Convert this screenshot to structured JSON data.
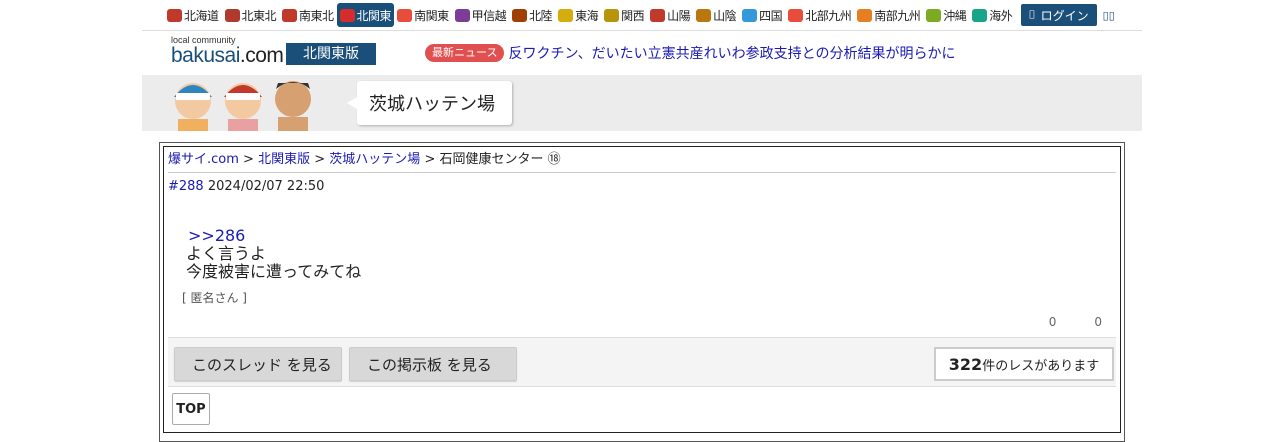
{
  "regions": [
    {
      "label": "北海道",
      "icon": "crab-icon",
      "color": "#c0392b"
    },
    {
      "label": "北東北",
      "icon": "namahage-icon",
      "color": "#b03a2e"
    },
    {
      "label": "南東北",
      "icon": "ship-icon",
      "color": "#c0392b"
    },
    {
      "label": "北関東",
      "icon": "daruma-icon",
      "color": "#d62c2c",
      "active": true
    },
    {
      "label": "南関東",
      "icon": "tower-icon",
      "color": "#e74c3c"
    },
    {
      "label": "甲信越",
      "icon": "grape-icon",
      "color": "#7d3c98"
    },
    {
      "label": "北陸",
      "icon": "shrine-icon",
      "color": "#a04000"
    },
    {
      "label": "東海",
      "icon": "shachihoko-icon",
      "color": "#d4ac0d"
    },
    {
      "label": "関西",
      "icon": "takoyaki-icon",
      "color": "#b7950b"
    },
    {
      "label": "山陽",
      "icon": "torii-icon",
      "color": "#c0392b"
    },
    {
      "label": "山陰",
      "icon": "camel-icon",
      "color": "#b9770e"
    },
    {
      "label": "四国",
      "icon": "udon-icon",
      "color": "#3498db"
    },
    {
      "label": "北部九州",
      "icon": "mentaiko-icon",
      "color": "#e74c3c"
    },
    {
      "label": "南部九州",
      "icon": "potato-icon",
      "color": "#e67e22"
    },
    {
      "label": "沖縄",
      "icon": "shisa-icon",
      "color": "#7daa23"
    },
    {
      "label": "海外",
      "icon": "globe-icon",
      "color": "#17a589"
    }
  ],
  "login_label": "ログイン",
  "logo": {
    "tag": "local community",
    "name_main": "bakusai",
    "name_suffix": ".com"
  },
  "edition": "北関東版",
  "news": {
    "badge": "最新ニュース",
    "headline": "反ワクチン、だいたい立憲共産れいわ参政支持との分析結果が明らかに"
  },
  "board_title": "茨城ハッテン場",
  "breadcrumb": {
    "site": "爆サイ.com",
    "edition": "北関東版",
    "board": "茨城ハッテン場",
    "sep": ">",
    "thread": "石岡健康センター ⑱"
  },
  "post": {
    "number": "#288",
    "datetime": "2024/02/07 22:50",
    "anchor": ">>286",
    "line1": "よく言うよ",
    "line2": "今度被害に遭ってみてね",
    "poster": "[ 匿名さん ]",
    "likes": "0",
    "dislikes": "0"
  },
  "actions": {
    "thread_button": "このスレッド を見る",
    "board_button": "この掲示板 を見る",
    "count_number": "322",
    "count_suffix": "件のレスがあります"
  },
  "top_label": "TOP"
}
